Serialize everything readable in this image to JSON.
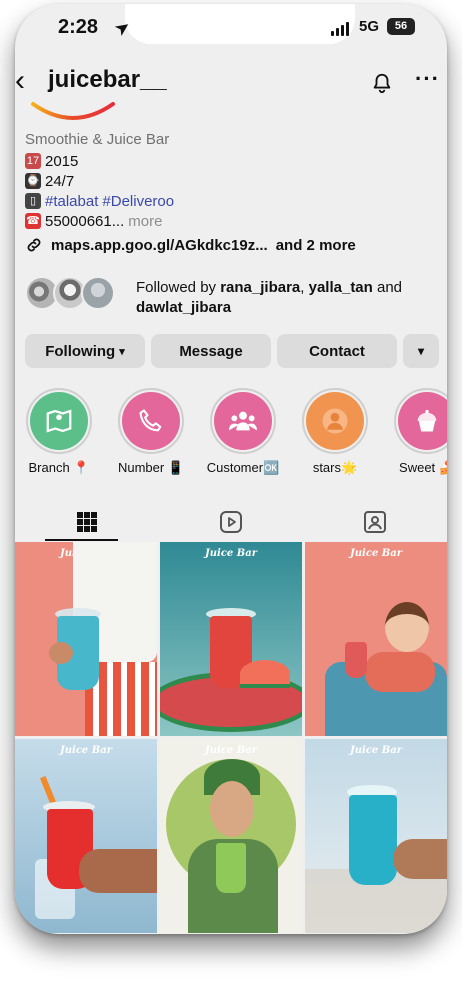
{
  "status": {
    "time": "2:28",
    "network": "5G",
    "battery": "56"
  },
  "profile": {
    "username": "juicebar__",
    "category": "Smoothie & Juice Bar",
    "bio_year": "2015",
    "bio_hours": "24/7",
    "bio_tag1": "#talabat",
    "bio_tag2": "#Deliveroo",
    "bio_phone": "55000661...",
    "bio_more": "more",
    "link": "maps.app.goo.gl/AGkdkc19z...",
    "link_more": "and 2 more"
  },
  "followed_by": {
    "prefix": "Followed by",
    "user1": "rana_jibara",
    "user2": "yalla_tan",
    "conj": "and",
    "user3": "dawlat_jibara"
  },
  "buttons": {
    "following": "Following",
    "message": "Message",
    "contact": "Contact"
  },
  "highlights": [
    {
      "label": "Branch 📍",
      "icon": "map-icon",
      "color": "#5cbf8a"
    },
    {
      "label": "Number 📱",
      "icon": "phone-icon",
      "color": "#e3679a"
    },
    {
      "label": "Customer🆗",
      "icon": "group-icon",
      "color": "#e3679a"
    },
    {
      "label": "stars🌟",
      "icon": "person-icon",
      "color": "#f0944f"
    },
    {
      "label": "Sweet 🍰",
      "icon": "cupcake-icon",
      "color": "#e3679a"
    }
  ],
  "tabs": [
    "grid-icon",
    "reels-icon",
    "tagged-icon"
  ],
  "posts": [
    {
      "brand": "Juice Bar",
      "bg": "#ec8d7f",
      "cup": "#47b8cc"
    },
    {
      "brand": "Juice Bar",
      "bg": "#3e9aa3",
      "cup": "#e2453d"
    },
    {
      "brand": "Juice Bar",
      "bg": "#ec8d7f",
      "cup": "#e15a5a"
    },
    {
      "brand": "Juice Bar",
      "bg": "#9ec2d8",
      "cup": "#e52e2e"
    },
    {
      "brand": "Juice Bar",
      "bg": "#a8c769",
      "cup": "#8fc95a"
    },
    {
      "brand": "Juice Bar",
      "bg": "#a7c8dc",
      "cup": "#29b0c9"
    }
  ]
}
